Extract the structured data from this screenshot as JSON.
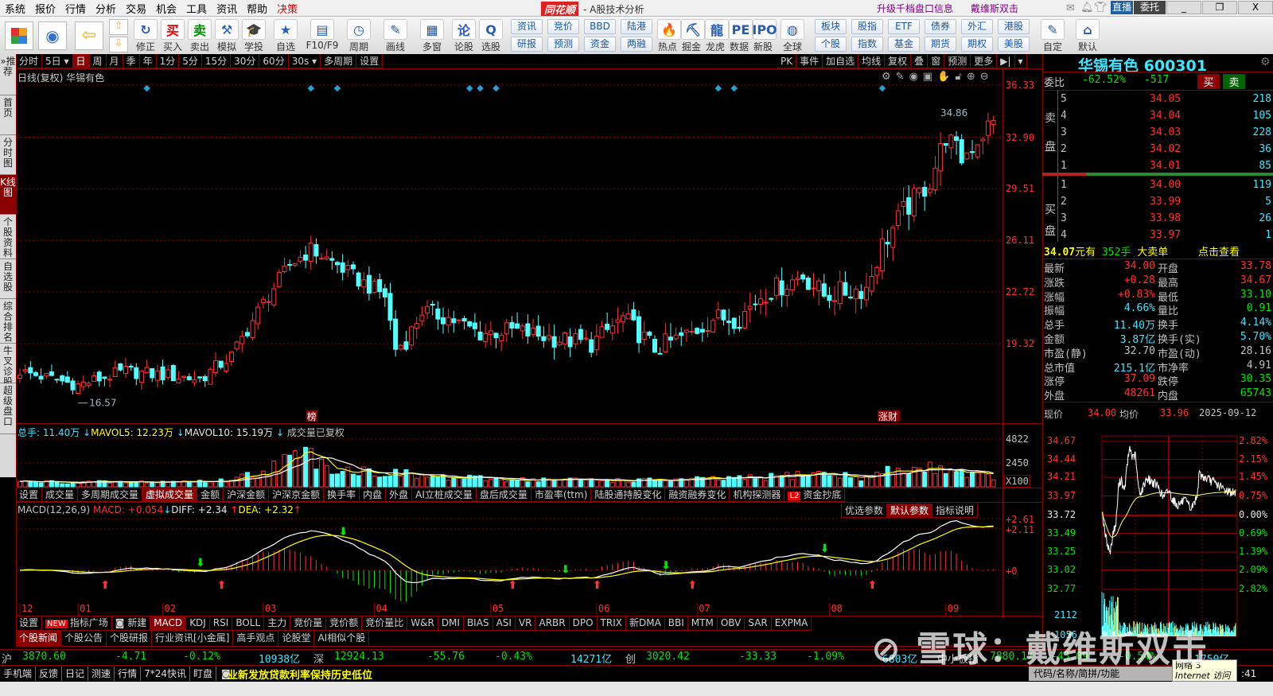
{
  "menu": [
    "系统",
    "报价",
    "行情",
    "分析",
    "交易",
    "机会",
    "工具",
    "资讯",
    "帮助",
    "决策"
  ],
  "title": {
    "logo": "同花顺",
    "subtitle": "- A股技术分析",
    "promo1": "升级千档盘口信息",
    "promo2": "戴维斯双击",
    "live": "直播",
    "entrust": "委托"
  },
  "toolbar": {
    "icons": [
      {
        "label": "修正",
        "glyph": "↻"
      },
      {
        "label": "买入",
        "glyph": "买"
      },
      {
        "label": "卖出",
        "glyph": "卖"
      },
      {
        "label": "模拟",
        "glyph": "⚒"
      },
      {
        "label": "学投资",
        "glyph": "🎓"
      },
      {
        "label": "自选",
        "glyph": "★"
      },
      {
        "label": "F10/F9",
        "glyph": "▤"
      },
      {
        "label": "周期",
        "glyph": "◷"
      },
      {
        "label": "画线",
        "glyph": "✎"
      },
      {
        "label": "多窗",
        "glyph": "▦"
      },
      {
        "label": "论股",
        "glyph": "论"
      },
      {
        "label": "选股",
        "glyph": "Q"
      }
    ],
    "pairs1": [
      [
        "资讯",
        "研报"
      ],
      [
        "竞价",
        "预测"
      ],
      [
        "BBD",
        "资金"
      ],
      [
        "陆港",
        "两融"
      ]
    ],
    "icons2": [
      {
        "label": "热点",
        "glyph": "🔥"
      },
      {
        "label": "掘金",
        "glyph": "⛏"
      },
      {
        "label": "龙虎",
        "glyph": "龍"
      },
      {
        "label": "数据",
        "glyph": "PE"
      },
      {
        "label": "新股",
        "glyph": "IPO"
      },
      {
        "label": "全球",
        "glyph": "◍"
      }
    ],
    "pairs2": [
      [
        "板块",
        "个股"
      ],
      [
        "股指",
        "指数"
      ],
      [
        "ETF",
        "基金"
      ],
      [
        "债券",
        "期货"
      ],
      [
        "外汇",
        "期权"
      ],
      [
        "港股",
        "美股"
      ]
    ],
    "icons3": [
      {
        "label": "自定",
        "glyph": "✎"
      },
      {
        "label": "默认",
        "glyph": "⌂"
      }
    ]
  },
  "sidebar": [
    {
      "label": "»推荐"
    },
    {
      "label": "首页"
    },
    {
      "label": "分时图"
    },
    {
      "label": "K线图",
      "active": true
    },
    {
      "label": "个股资料"
    },
    {
      "label": "自选股"
    },
    {
      "label": "综合排名"
    },
    {
      "label": "牛叉诊股"
    },
    {
      "label": "超级盘口"
    }
  ],
  "period_tabs": [
    "分时",
    "5日 ▾",
    "日",
    "周",
    "月",
    "季",
    "年",
    "1分",
    "5分",
    "15分",
    "30分",
    "60分",
    "30s ▾",
    "多周期",
    "设置"
  ],
  "right_tabs": [
    "PK",
    "事件",
    "加自选",
    "均线",
    "复权",
    "叠",
    "窗",
    "预测",
    "更多",
    "▶|",
    "▾"
  ],
  "chart_title": "日线(复权)  华锡有色",
  "stock": {
    "name": "华锡有色",
    "code": "600301"
  },
  "chart_data": {
    "type": "candlestick",
    "price_axis": [
      "36.33",
      "32.90",
      "29.51",
      "26.11",
      "22.72",
      "19.32"
    ],
    "ylim": [
      19.32,
      36.33
    ],
    "months": [
      "12",
      "01",
      "02",
      "03",
      "04",
      "05",
      "06",
      "07",
      "08",
      "09"
    ],
    "month_bar_index": [
      0,
      11,
      27,
      46,
      67,
      89,
      109,
      128,
      153,
      175
    ],
    "close_keypoints": [
      [
        0,
        17.5
      ],
      [
        11,
        16.6
      ],
      [
        20,
        17.5
      ],
      [
        34,
        17
      ],
      [
        40,
        18.5
      ],
      [
        46,
        22
      ],
      [
        51,
        24.5
      ],
      [
        55,
        25.5
      ],
      [
        60,
        24.5
      ],
      [
        64,
        23.5
      ],
      [
        69,
        22.5
      ],
      [
        71,
        19
      ],
      [
        73,
        19.5
      ],
      [
        76,
        21.5
      ],
      [
        81,
        21
      ],
      [
        87,
        20
      ],
      [
        93,
        20.2
      ],
      [
        102,
        19.6
      ],
      [
        108,
        19.3
      ],
      [
        114,
        21
      ],
      [
        120,
        19
      ],
      [
        127,
        20
      ],
      [
        131,
        21
      ],
      [
        136,
        21
      ],
      [
        140,
        22.5
      ],
      [
        148,
        23.8
      ],
      [
        152,
        22.5
      ],
      [
        160,
        23
      ],
      [
        163,
        25.8
      ],
      [
        167,
        28
      ],
      [
        172,
        30
      ],
      [
        175,
        33
      ],
      [
        178,
        31.5
      ],
      [
        184,
        34.0
      ]
    ],
    "bar_count": 185,
    "max_label": "34.86",
    "min_label": "16.57",
    "event_diamonds": [
      24,
      55,
      60,
      85,
      87,
      90,
      132,
      135,
      163
    ],
    "tags": [
      {
        "index": 55,
        "text": "榜"
      },
      {
        "index": 163,
        "text": "涨财"
      }
    ],
    "volume": {
      "info": {
        "total_label": "总手: 11.40万",
        "mavol5_label": "MAVOL5: 12.23万",
        "mavol10_label": "MAVOL10: 15.19万",
        "note": "成交量已复权"
      },
      "axis": [
        "4822",
        "2450"
      ],
      "unit": "X100",
      "max": 4822,
      "keypoints": [
        [
          0,
          500
        ],
        [
          20,
          450
        ],
        [
          38,
          600
        ],
        [
          45,
          1400
        ],
        [
          50,
          2600
        ],
        [
          55,
          3200
        ],
        [
          60,
          1800
        ],
        [
          70,
          1400
        ],
        [
          80,
          900
        ],
        [
          100,
          700
        ],
        [
          120,
          650
        ],
        [
          140,
          900
        ],
        [
          150,
          1400
        ],
        [
          160,
          900
        ],
        [
          163,
          1500
        ],
        [
          170,
          1800
        ],
        [
          175,
          2000
        ],
        [
          180,
          1300
        ],
        [
          184,
          1140
        ]
      ]
    },
    "macd": {
      "label": "MACD(12,26,9)",
      "macd_label": "MACD: +0.054",
      "diff_label": "DIFF: +2.34",
      "dea_label": "DEA: +2.32",
      "axis": [
        "+2.61",
        "+2.11",
        "+0"
      ],
      "buy_signals": [
        16,
        38,
        93,
        109,
        127,
        161
      ],
      "sell_signals": [
        34,
        61,
        103,
        122,
        152
      ]
    }
  },
  "indicator_tabs_top": [
    "设置",
    "成交量",
    "多周期成交量",
    "虚拟成交量",
    "金额",
    "沪深金额",
    "沪深京金额",
    "换手率",
    "内盘",
    "外盘",
    "AI立桩成交量",
    "盘后成交量",
    "市盈率(ttm)",
    "陆股通持股变化",
    "融资融券变化",
    "机构探测器",
    "资金抄底"
  ],
  "param_tabs": [
    "优选参数",
    "默认参数",
    "指标说明"
  ],
  "indicator_tabs": [
    "设置",
    "指标广场",
    "新建",
    "MACD",
    "KDJ",
    "RSI",
    "BOLL",
    "主力",
    "竞价量",
    "竞价额",
    "竞价量比",
    "W&R",
    "DMI",
    "BIAS",
    "ASI",
    "VR",
    "ARBR",
    "DPO",
    "TRIX",
    "新DMA",
    "BBI",
    "MTM",
    "OBV",
    "SAR",
    "EXPMA"
  ],
  "new_badge": "NEW",
  "l2_badge": "L2",
  "news_tabs": [
    "个股新闻",
    "个股公告",
    "个股研报",
    "行业资讯[小金属]",
    "高手观点",
    "论股堂",
    "AI相似个股"
  ],
  "orderbook": {
    "weibi_label": "委比",
    "weibi": "-62.52%",
    "weicha": "-517",
    "buy": "买",
    "sell": "卖",
    "ask_label": [
      "卖",
      "盘"
    ],
    "bid_label": [
      "买",
      "盘"
    ],
    "asks": [
      {
        "lvl": "5",
        "price": "34.05",
        "vol": "218"
      },
      {
        "lvl": "4",
        "price": "34.04",
        "vol": "105"
      },
      {
        "lvl": "3",
        "price": "34.03",
        "vol": "228"
      },
      {
        "lvl": "2",
        "price": "34.02",
        "vol": "36"
      },
      {
        "lvl": "1",
        "price": "34.01",
        "vol": "85"
      }
    ],
    "bids": [
      {
        "lvl": "1",
        "price": "34.00",
        "vol": "119"
      },
      {
        "lvl": "2",
        "price": "33.99",
        "vol": "5"
      },
      {
        "lvl": "3",
        "price": "33.98",
        "vol": "26"
      },
      {
        "lvl": "4",
        "price": "33.97",
        "vol": "1"
      }
    ],
    "bid_ratio": 0.19,
    "bigorder": {
      "price": "34.07",
      "p1": "元有",
      "qty": "352手",
      "p2": "大卖单",
      "link": "点击查看"
    }
  },
  "stats": [
    {
      "l": "最新",
      "v": "34.00",
      "c": "red",
      "l2": "开盘",
      "v2": "33.78",
      "c2": "red"
    },
    {
      "l": "涨跌",
      "v": "+0.28",
      "c": "red",
      "l2": "最高",
      "v2": "34.67",
      "c2": "red"
    },
    {
      "l": "涨幅",
      "v": "+0.83%",
      "c": "red",
      "l2": "最低",
      "v2": "33.10",
      "c2": "green"
    },
    {
      "l": "振幅",
      "v": "4.66%",
      "c": "cyan",
      "l2": "量比",
      "v2": "0.91",
      "c2": "green"
    },
    {
      "l": "总手",
      "v": "11.40万",
      "c": "cyan",
      "l2": "换手",
      "v2": "4.14%",
      "c2": "cyan"
    },
    {
      "l": "金额",
      "v": "3.87亿",
      "c": "cyan",
      "l2": "换手(实)",
      "v2": "5.70%",
      "c2": "cyan"
    },
    {
      "l": "市盈(静)",
      "v": "32.70",
      "c": "gray",
      "l2": "市盈(动)",
      "v2": "28.16",
      "c2": "gray"
    },
    {
      "l": "总市值",
      "v": "215.1亿",
      "c": "cyan",
      "l2": "市净率",
      "v2": "4.91",
      "c2": "gray"
    },
    {
      "l": "涨停",
      "v": "37.09",
      "c": "red",
      "l2": "跌停",
      "v2": "30.35",
      "c2": "green"
    },
    {
      "l": "外盘",
      "v": "48261",
      "c": "red",
      "l2": "内盘",
      "v2": "65743",
      "c2": "green"
    }
  ],
  "intraday": {
    "now_label": "现价",
    "now": "34.00",
    "avg_label": "均价",
    "avg": "33.96",
    "date": "2025-09-12",
    "left_axis": [
      "34.67",
      "34.44",
      "34.21",
      "33.97",
      "33.72",
      "33.49",
      "33.25",
      "33.02",
      "32.77"
    ],
    "right_axis": [
      "2.82%",
      "2.15%",
      "1.45%",
      "0.75%",
      "0.00%",
      "0.69%",
      "1.39%",
      "2.09%",
      "2.82%"
    ],
    "vol_axis": [
      "2112",
      "1056"
    ],
    "ylim": [
      32.77,
      34.67
    ],
    "prev_close": 33.72,
    "keypoints": [
      [
        0,
        33.8
      ],
      [
        5,
        33.5
      ],
      [
        12,
        33.3
      ],
      [
        15,
        33.25
      ],
      [
        20,
        33.5
      ],
      [
        25,
        33.6
      ],
      [
        30,
        34.1
      ],
      [
        35,
        34.2
      ],
      [
        40,
        34.0
      ],
      [
        45,
        34.35
      ],
      [
        50,
        34.6
      ],
      [
        55,
        34.45
      ],
      [
        60,
        34.5
      ],
      [
        65,
        34.1
      ],
      [
        70,
        34.0
      ],
      [
        80,
        34.2
      ],
      [
        90,
        34.15
      ],
      [
        100,
        34.1
      ],
      [
        110,
        33.95
      ],
      [
        120,
        34.05
      ],
      [
        125,
        33.95
      ],
      [
        135,
        33.85
      ],
      [
        145,
        33.9
      ],
      [
        150,
        33.9
      ],
      [
        160,
        33.8
      ],
      [
        170,
        33.95
      ],
      [
        175,
        34.25
      ],
      [
        185,
        34.2
      ],
      [
        200,
        34.15
      ],
      [
        220,
        34.05
      ],
      [
        240,
        34.0
      ]
    ]
  },
  "indices": [
    {
      "name": "沪",
      "val": "3870.60",
      "chg": "-4.71",
      "pct": "-0.12%",
      "amt": "10938亿"
    },
    {
      "name": "深",
      "val": "12924.13",
      "chg": "-55.76",
      "pct": "-0.43%",
      "amt": "14271亿"
    },
    {
      "name": "创",
      "val": "3020.42",
      "chg": "-33.33",
      "pct": "-1.09%",
      "amt": "6803亿"
    },
    {
      "name": "中小板指",
      "val": "7880.17",
      "chg": "-43.09",
      "pct": "-0.54%",
      "amt": "1750亿"
    }
  ],
  "status": {
    "items": [
      "手机端",
      "反馈",
      "日记",
      "测速",
      "行情",
      "7*24快讯",
      "盯盘"
    ],
    "ticker": "业新发放贷款利率保持历史低位",
    "search_placeholder": "代码/名称/简拼/功能",
    "tip1": "网络  3",
    "tip2": "Internet 访问",
    "time": ":41"
  },
  "watermark": "雪球：戴维斯双击"
}
